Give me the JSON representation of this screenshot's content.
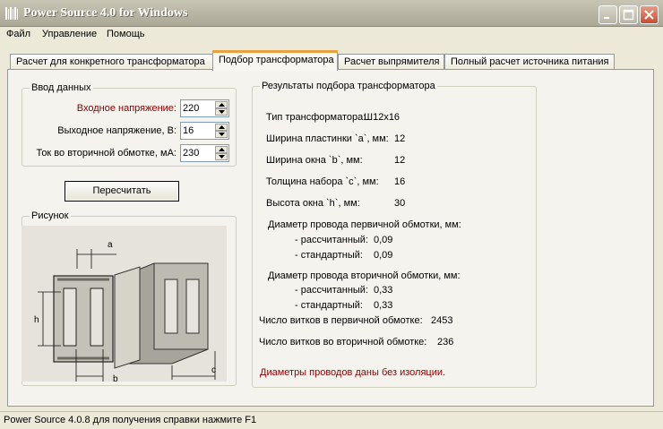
{
  "window": {
    "title": "Power Source 4.0 for Windows",
    "icon": "app-barcode-icon"
  },
  "menu": [
    "Файл",
    "Управление",
    "Помощь"
  ],
  "tabs": [
    "Расчет для конкретного трансформатора",
    "Подбор трансформатора",
    "Расчет выпрямителя",
    "Полный расчет источника питания"
  ],
  "active_tab": "Подбор трансформатора",
  "input": {
    "title": "Ввод данных",
    "fields": [
      {
        "label": "Входное напряжение:",
        "value": "220"
      },
      {
        "label": "Выходное напряжение, В:",
        "value": "16"
      },
      {
        "label": "Ток во вторичной обмотке, мА:",
        "value": "230"
      }
    ]
  },
  "recalc_button": "Пересчитать",
  "picture": {
    "title": "Рисунок",
    "dim_labels": [
      "a",
      "h",
      "b",
      "c"
    ]
  },
  "results": {
    "title": "Результаты подбора трансформатора",
    "type_label": "Тип трансформатора:",
    "type_value": "Ш12х16",
    "rows": [
      {
        "label": "Ширина пластинки `a`, мм:",
        "value": "12"
      },
      {
        "label": "Ширина окна `b`, мм:",
        "value": "12"
      },
      {
        "label": "Толщина набора `c`, мм:",
        "value": "16"
      },
      {
        "label": "Высота окна `h`, мм:",
        "value": "30"
      }
    ],
    "primary_title": "Диаметр провода первичной обмотки, мм:",
    "primary": [
      {
        "label": "- рассчитанный:",
        "value": "0,09"
      },
      {
        "label": "- стандартный:",
        "value": "0,09"
      }
    ],
    "secondary_title": "Диаметр провода вторичной обмотки, мм:",
    "secondary": [
      {
        "label": "- рассчитанный:",
        "value": "0,33"
      },
      {
        "label": "- стандартный:",
        "value": "0,33"
      }
    ],
    "turns_primary_label": "Число витков в первичной обмотке:",
    "turns_primary_value": "2453",
    "turns_secondary_label": "Число витков во вторичной обмотке:",
    "turns_secondary_value": "236",
    "note": "Диаметры проводов даны без изоляции."
  },
  "status": "Power Source 4.0.8 для получения справки нажмите F1",
  "colors": {
    "note_text": "#8b0000",
    "active_tab_accent": "#e6a23c",
    "close_button": "#c74e2f"
  }
}
